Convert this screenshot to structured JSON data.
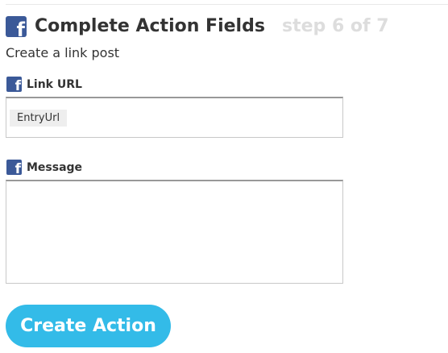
{
  "colors": {
    "facebook_blue": "#3b5998",
    "button_blue": "#33bbe8",
    "step_gray": "#dddddd",
    "text": "#333333"
  },
  "header": {
    "icon": "facebook-icon",
    "title": "Complete Action Fields",
    "step": "step 6 of 7",
    "subtitle": "Create a link post"
  },
  "fields": [
    {
      "icon": "facebook-icon",
      "label": "Link URL",
      "value_token": "EntryUrl"
    },
    {
      "icon": "facebook-icon",
      "label": "Message",
      "value": ""
    }
  ],
  "actions": {
    "create_label": "Create Action"
  }
}
